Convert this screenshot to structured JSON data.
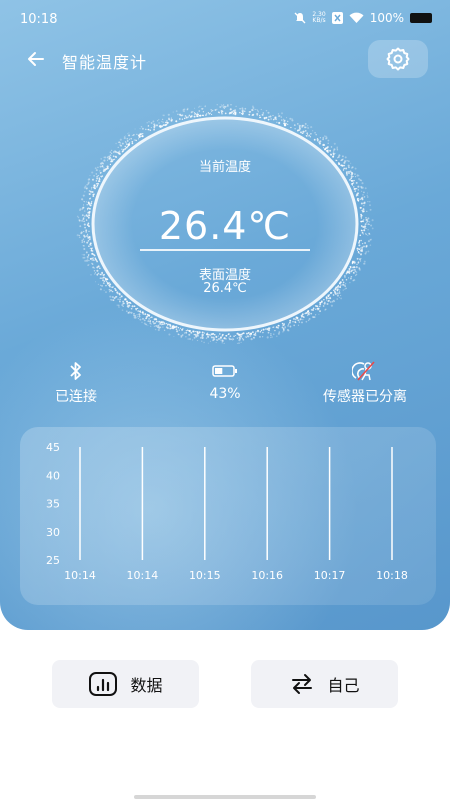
{
  "status_bar": {
    "time": "10:18",
    "net_speed_value": "2.30",
    "net_speed_unit": "KB/s",
    "battery": "100%"
  },
  "header": {
    "title": "智能温度计"
  },
  "gauge": {
    "current_label": "当前温度",
    "current_value": "26.4℃",
    "surface_label": "表面温度",
    "surface_value": "26.4℃"
  },
  "status_items": {
    "bluetooth": "已连接",
    "battery": "43%",
    "sensor": "传感器已分离"
  },
  "chart_data": {
    "type": "bar",
    "categories": [
      "10:14",
      "10:14",
      "10:15",
      "10:16",
      "10:17",
      "10:18"
    ],
    "values": [
      45,
      45,
      45,
      45,
      45,
      45
    ],
    "ylim": [
      25,
      45
    ],
    "yticks": [
      25,
      30,
      35,
      40,
      45
    ],
    "grid": false,
    "title": "",
    "xlabel": "",
    "ylabel": ""
  },
  "buttons": {
    "data_label": "数据",
    "self_label": "自己"
  },
  "colors": {
    "hero_top": "#8fc3e6",
    "hero_bottom": "#5897cc",
    "button_bg": "#f1f2f6"
  }
}
